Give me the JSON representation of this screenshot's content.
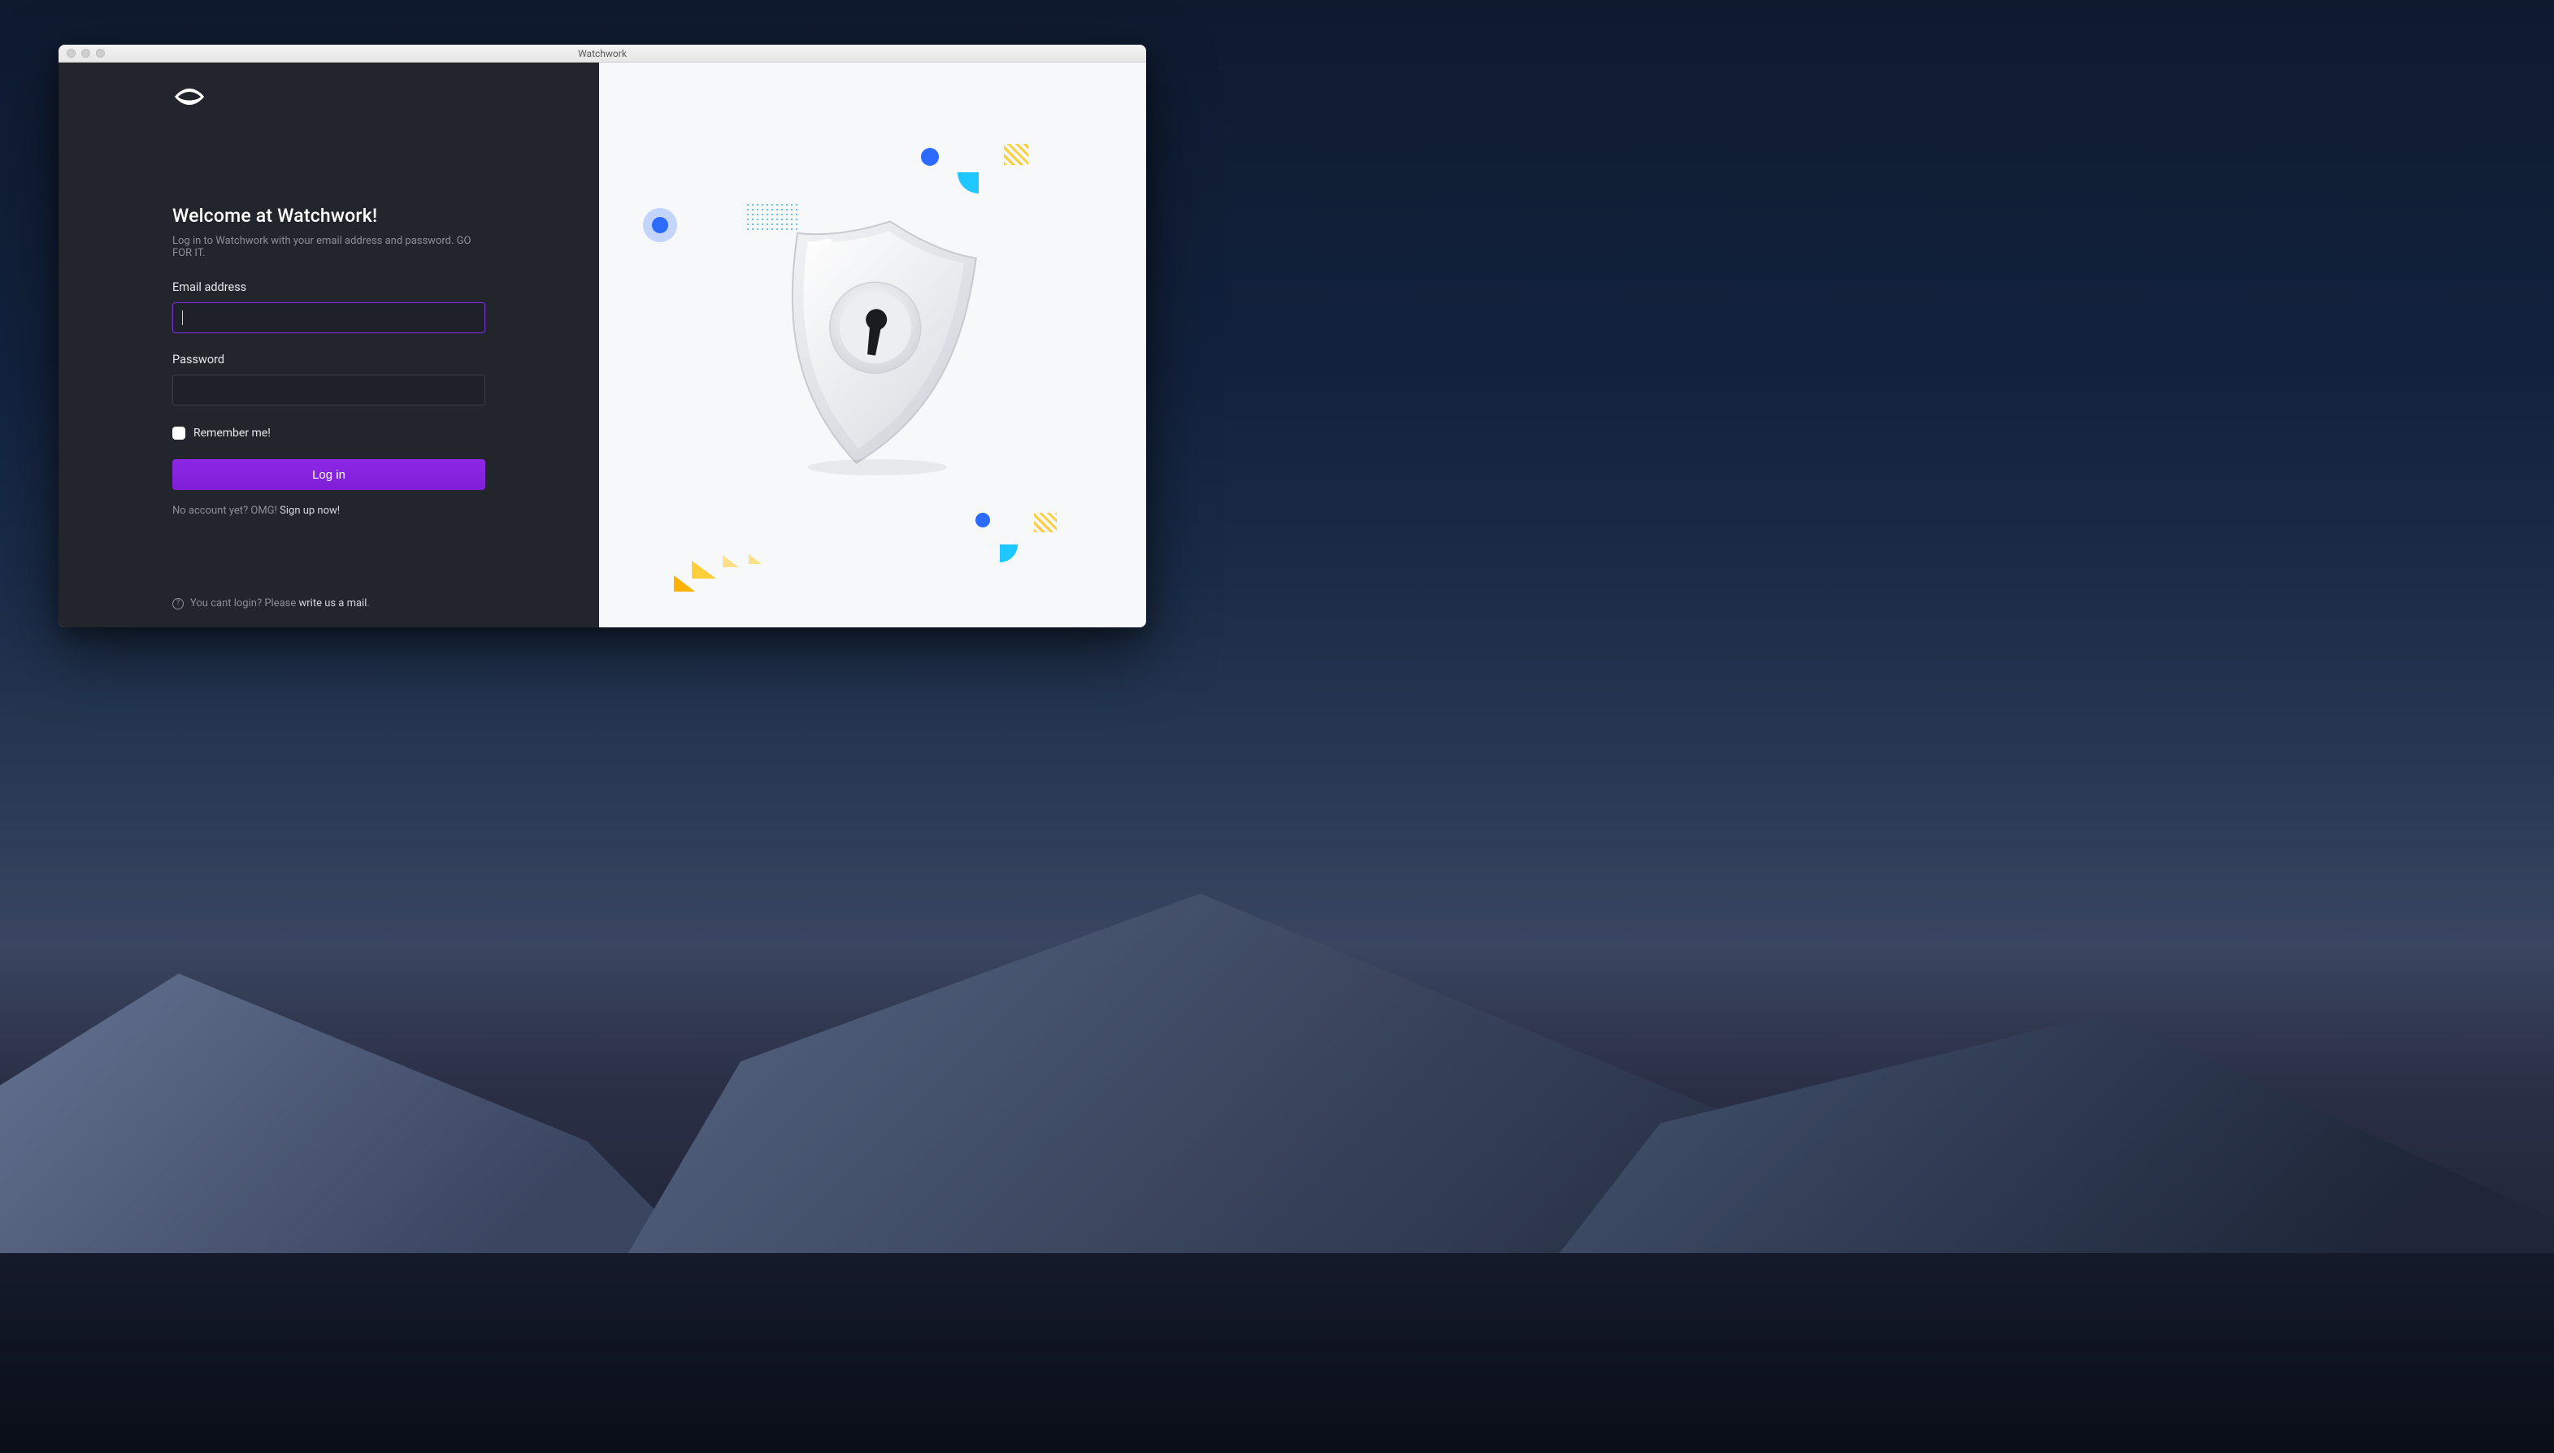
{
  "window_title": "Watchwork",
  "login": {
    "headline": "Welcome at Watchwork!",
    "subhead": "Log in to Watchwork with your email address and password. GO FOR IT.",
    "email_label": "Email address",
    "email_value": "",
    "password_label": "Password",
    "password_value": "",
    "remember_label": "Remember me!",
    "submit_label": "Log in",
    "signup_prefix": "No account yet? OMG! ",
    "signup_link": "Sign up now!",
    "help_prefix": "You cant login? Please ",
    "help_link": "write us a mail",
    "help_suffix": "."
  },
  "colors": {
    "left_bg": "#22252c",
    "accent": "#8a2be2",
    "focus_border": "#7a2ed6",
    "right_bg": "#f6f8fa",
    "text_muted": "#8d8f97",
    "blue": "#2d6bff",
    "cyan": "#1ec7ff",
    "yellow": "#ffce3a"
  }
}
